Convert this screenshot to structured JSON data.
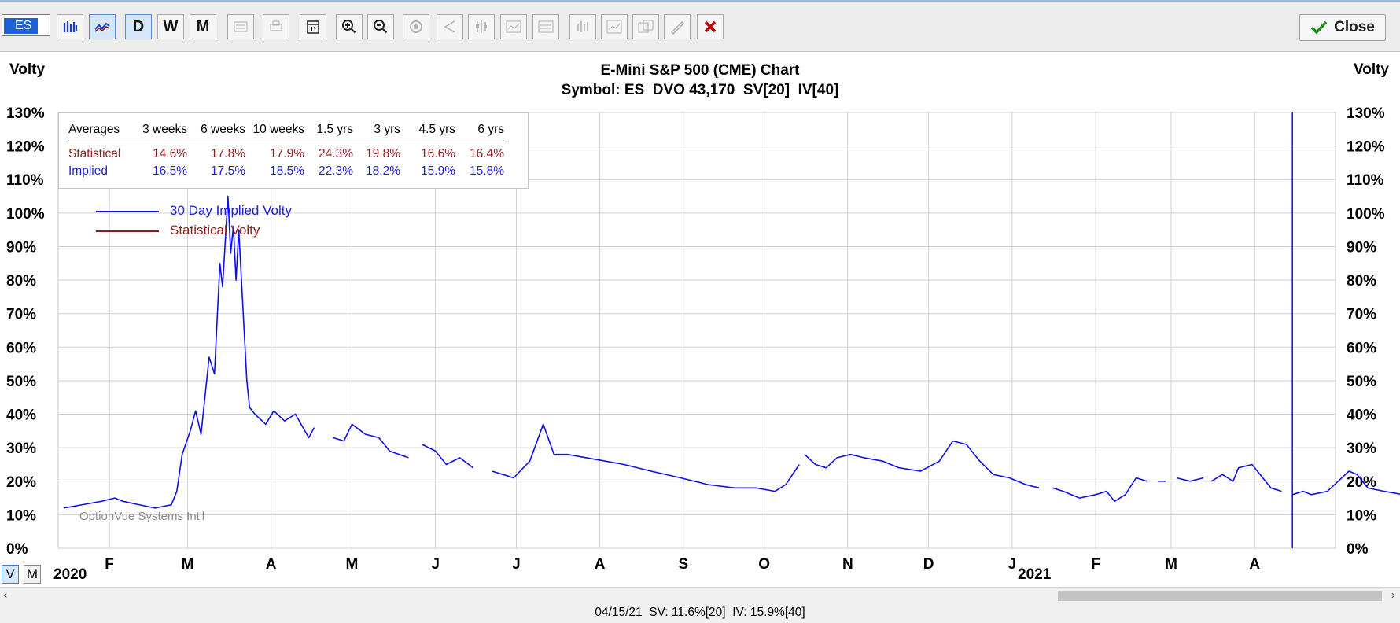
{
  "toolbar": {
    "symbol_value": "ES",
    "buttons": [
      "price-chart",
      "volatility-chart",
      "D",
      "W",
      "M"
    ],
    "close_label": "Close",
    "colors": {
      "active_bg": "#d6e6fb",
      "close_x": "#c00000",
      "check": "#1a8a1a"
    }
  },
  "chart": {
    "title": "E-Mini S&P 500 (CME) Chart",
    "subtitle": "Symbol: ES  DVO 43,170  SV[20]  IV[40]",
    "left_axis_label": "Volty",
    "right_axis_label": "Volty",
    "watermark": "OptionVue Systems Int'l",
    "year_labels": [
      "2020",
      "2021"
    ]
  },
  "averages": {
    "header": [
      "Averages",
      "3 weeks",
      "6 weeks",
      "10 weeks",
      "1.5 yrs",
      "3 yrs",
      "4.5 yrs",
      "6 yrs"
    ],
    "rows": [
      {
        "label": "Statistical",
        "values": [
          "14.6%",
          "17.8%",
          "17.9%",
          "24.3%",
          "19.8%",
          "16.6%",
          "16.4%"
        ]
      },
      {
        "label": "Implied",
        "values": [
          "16.5%",
          "17.5%",
          "18.5%",
          "22.3%",
          "18.2%",
          "15.9%",
          "15.8%"
        ]
      }
    ]
  },
  "legend": {
    "implied": "30 Day Implied Volty",
    "statistical": "Statistical Volty"
  },
  "view_toggle": {
    "v": "V",
    "m": "M",
    "active": "V"
  },
  "status": "04/15/21  SV: 11.6%[20]  IV: 15.9%[40]",
  "chart_data": {
    "type": "line",
    "ylim": [
      0,
      130
    ],
    "yticks": [
      "0%",
      "10%",
      "20%",
      "30%",
      "40%",
      "50%",
      "60%",
      "70%",
      "80%",
      "90%",
      "100%",
      "110%",
      "120%",
      "130%"
    ],
    "month_ticks": [
      "F",
      "M",
      "A",
      "M",
      "J",
      "J",
      "A",
      "S",
      "O",
      "N",
      "D",
      "J",
      "F",
      "M",
      "A"
    ],
    "x_start": "2020-01-13",
    "x_end": "2021-05-01",
    "month_tick_dates": [
      "2020-02-01",
      "2020-03-01",
      "2020-04-01",
      "2020-05-01",
      "2020-06-01",
      "2020-07-01",
      "2020-08-01",
      "2020-09-01",
      "2020-10-01",
      "2020-11-01",
      "2020-12-01",
      "2021-01-01",
      "2021-02-01",
      "2021-03-01",
      "2021-04-01"
    ],
    "current_date": "2021-04-15",
    "colors": {
      "implied": "#1010e8",
      "statistical": "#8b1a1a",
      "grid": "#d0d0d0"
    },
    "series": [
      {
        "name": "30 Day Implied Volty",
        "key": "implied",
        "points": [
          [
            "2020-01-15",
            12
          ],
          [
            "2020-01-22",
            13
          ],
          [
            "2020-01-29",
            14
          ],
          [
            "2020-02-03",
            15
          ],
          [
            "2020-02-06",
            14
          ],
          [
            "2020-02-12",
            13
          ],
          [
            "2020-02-18",
            12
          ],
          [
            "2020-02-24",
            13
          ],
          [
            "2020-02-26",
            17
          ],
          [
            "2020-02-28",
            28
          ],
          [
            "2020-03-02",
            35
          ],
          [
            "2020-03-04",
            41
          ],
          [
            "2020-03-06",
            34
          ],
          [
            "2020-03-09",
            57
          ],
          [
            "2020-03-11",
            52
          ],
          [
            "2020-03-13",
            85
          ],
          [
            "2020-03-14",
            78
          ],
          [
            "2020-03-16",
            105
          ],
          [
            "2020-03-17",
            88
          ],
          [
            "2020-03-18",
            96
          ],
          [
            "2020-03-19",
            80
          ],
          [
            "2020-03-20",
            95
          ],
          [
            "2020-03-23",
            50
          ],
          [
            "2020-03-24",
            42
          ],
          [
            "2020-03-26",
            40
          ],
          [
            "2020-03-30",
            37
          ],
          [
            "2020-04-02",
            41
          ],
          [
            "2020-04-06",
            38
          ],
          [
            "2020-04-10",
            40
          ],
          [
            "2020-04-15",
            33
          ],
          [
            "2020-04-17",
            36
          ],
          [
            null,
            null
          ],
          [
            "2020-04-24",
            33
          ],
          [
            "2020-04-28",
            32
          ],
          [
            "2020-05-01",
            37
          ],
          [
            "2020-05-06",
            34
          ],
          [
            "2020-05-11",
            33
          ],
          [
            "2020-05-15",
            29
          ],
          [
            "2020-05-22",
            27
          ],
          [
            null,
            null
          ],
          [
            "2020-05-27",
            31
          ],
          [
            "2020-06-01",
            29
          ],
          [
            "2020-06-05",
            25
          ],
          [
            "2020-06-10",
            27
          ],
          [
            "2020-06-15",
            24
          ],
          [
            null,
            null
          ],
          [
            "2020-06-22",
            23
          ],
          [
            "2020-06-26",
            22
          ],
          [
            "2020-06-30",
            21
          ],
          [
            "2020-07-06",
            26
          ],
          [
            "2020-07-11",
            37
          ],
          [
            "2020-07-15",
            28
          ],
          [
            "2020-07-20",
            28
          ],
          [
            "2020-07-27",
            27
          ],
          [
            "2020-08-03",
            26
          ],
          [
            "2020-08-10",
            25
          ],
          [
            "2020-08-20",
            23
          ],
          [
            "2020-08-31",
            21
          ],
          [
            "2020-09-10",
            19
          ],
          [
            "2020-09-20",
            18
          ],
          [
            "2020-09-28",
            18
          ],
          [
            "2020-10-05",
            17
          ],
          [
            "2020-10-09",
            19
          ],
          [
            "2020-10-14",
            25
          ],
          [
            null,
            null
          ],
          [
            "2020-10-16",
            28
          ],
          [
            "2020-10-20",
            25
          ],
          [
            "2020-10-24",
            24
          ],
          [
            "2020-10-28",
            27
          ],
          [
            "2020-11-02",
            28
          ],
          [
            "2020-11-07",
            27
          ],
          [
            "2020-11-14",
            26
          ],
          [
            "2020-11-20",
            24
          ],
          [
            "2020-11-28",
            23
          ],
          [
            "2020-12-05",
            26
          ],
          [
            "2020-12-10",
            32
          ],
          [
            "2020-12-15",
            31
          ],
          [
            "2020-12-20",
            26
          ],
          [
            "2020-12-25",
            22
          ],
          [
            "2020-12-31",
            21
          ],
          [
            "2021-01-06",
            19
          ],
          [
            "2021-01-11",
            18
          ],
          [
            null,
            null
          ],
          [
            "2021-01-16",
            18
          ],
          [
            "2021-01-20",
            17
          ],
          [
            "2021-01-26",
            15
          ],
          [
            "2021-02-01",
            16
          ],
          [
            "2021-02-05",
            17
          ],
          [
            "2021-02-08",
            14
          ],
          [
            "2021-02-12",
            16
          ],
          [
            "2021-02-16",
            21
          ],
          [
            "2021-02-20",
            20
          ],
          [
            null,
            null
          ],
          [
            "2021-02-24",
            20
          ],
          [
            "2021-02-27",
            20
          ],
          [
            null,
            null
          ],
          [
            "2021-03-03",
            21
          ],
          [
            "2021-03-08",
            20
          ],
          [
            "2021-03-13",
            21
          ],
          [
            null,
            null
          ],
          [
            "2021-03-16",
            20
          ],
          [
            "2021-03-20",
            22
          ],
          [
            "2021-03-24",
            20
          ],
          [
            "2021-03-26",
            24
          ],
          [
            "2021-03-31",
            25
          ],
          [
            "2021-04-03",
            22
          ],
          [
            "2021-04-07",
            18
          ],
          [
            "2021-04-11",
            17
          ],
          [
            null,
            null
          ],
          [
            "2021-04-15",
            16
          ],
          [
            "2021-04-19",
            17
          ],
          [
            "2021-04-22",
            16
          ],
          [
            "2021-04-28",
            17
          ],
          [
            "2021-05-02",
            20
          ],
          [
            "2021-05-06",
            23
          ],
          [
            "2021-05-09",
            22
          ],
          [
            "2021-05-13",
            18
          ],
          [
            "2021-05-19",
            17
          ],
          [
            "2021-05-26",
            16
          ]
        ]
      }
    ]
  }
}
